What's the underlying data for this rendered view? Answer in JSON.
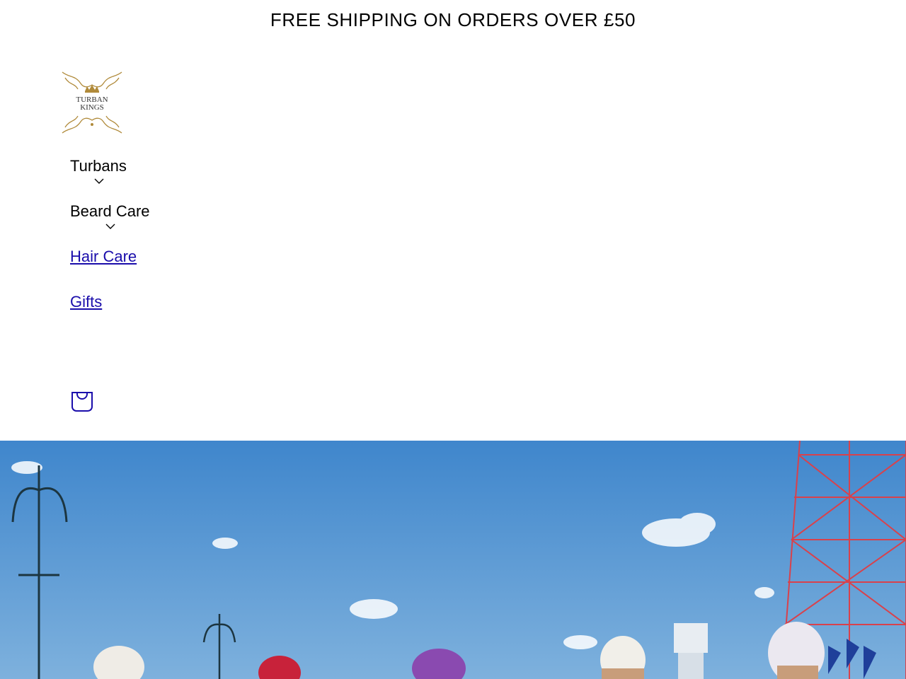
{
  "announcement": {
    "text": "FREE SHIPPING ON ORDERS OVER £50"
  },
  "logo": {
    "line1": "TURBAN",
    "line2": "KINGS",
    "color": "#b08a3a"
  },
  "nav": {
    "items": [
      {
        "label": "Turbans",
        "type": "dropdown",
        "icon": "chevron-down-icon"
      },
      {
        "label": "Beard Care",
        "type": "dropdown",
        "icon": "chevron-down-icon"
      },
      {
        "label": "Hair Care",
        "type": "link"
      },
      {
        "label": "Gifts",
        "type": "link"
      }
    ]
  },
  "cart": {
    "icon": "shopping-bag-icon",
    "color": "#1a0dab"
  },
  "hero": {
    "colors": {
      "sky": "#4f93cf",
      "tower": "#d9414b"
    }
  }
}
